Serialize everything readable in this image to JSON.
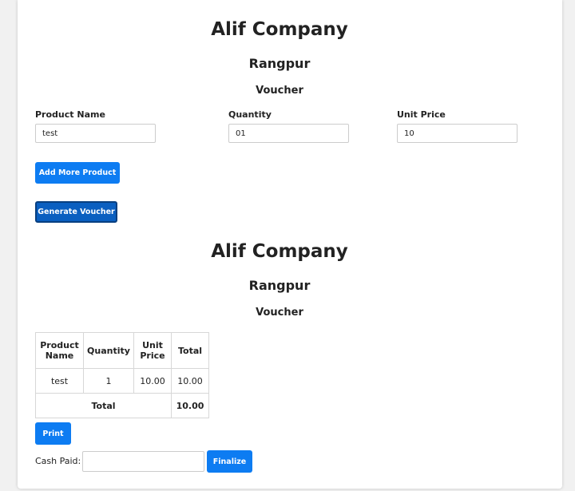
{
  "form": {
    "company": "Alif Company",
    "city": "Rangpur",
    "heading": "Voucher",
    "fields": {
      "product_name": {
        "label": "Product Name",
        "value": "test"
      },
      "quantity": {
        "label": "Quantity",
        "value": "01"
      },
      "unit_price": {
        "label": "Unit Price",
        "value": "10"
      }
    },
    "add_more_label": "Add More Product",
    "generate_label": "Generate Voucher"
  },
  "voucher": {
    "company": "Alif Company",
    "city": "Rangpur",
    "heading": "Voucher",
    "table": {
      "headers": {
        "product_name": "Product Name",
        "quantity": "Quantity",
        "unit_price": "Unit Price",
        "total": "Total"
      },
      "rows": [
        {
          "product": "test",
          "quantity": "1",
          "unit_price": "10.00",
          "total": "10.00"
        }
      ],
      "footer": {
        "label": "Total",
        "value": "10.00"
      }
    },
    "print_label": "Print",
    "cash_paid_label": "Cash Paid:",
    "cash_paid_value": "",
    "finalize_label": "Finalize"
  },
  "colors": {
    "accent": "#0d7cf2",
    "accent_dark": "#0a5fc0"
  }
}
